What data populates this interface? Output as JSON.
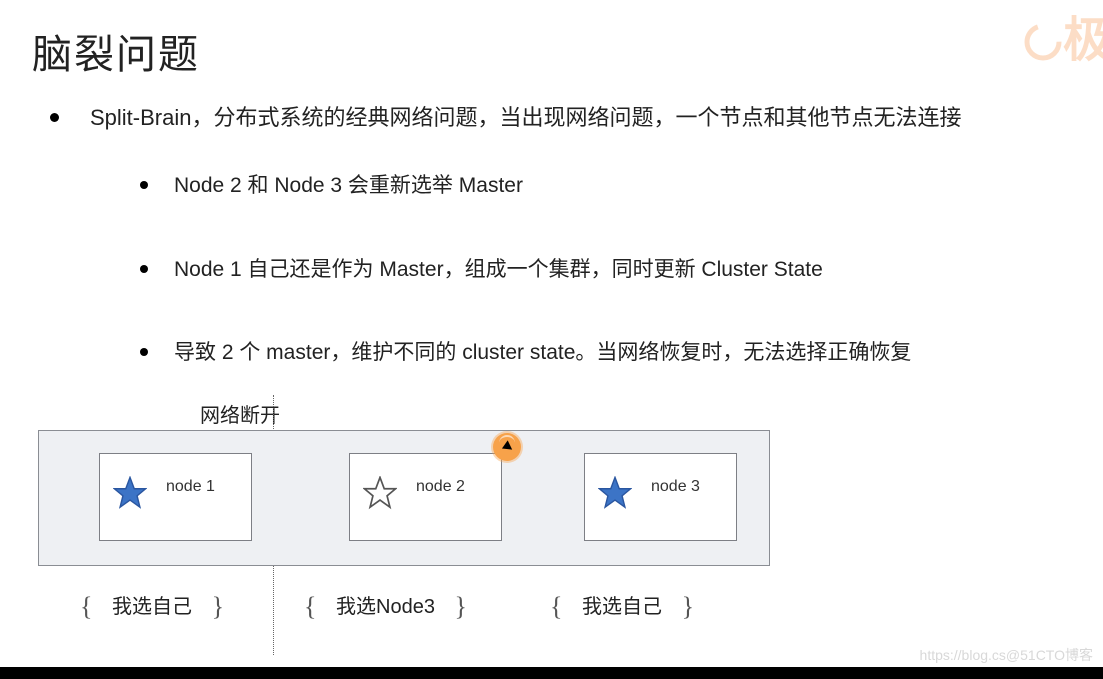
{
  "title": "脑裂问题",
  "logo_text": "极",
  "bullets": {
    "main": "Split-Brain，分布式系统的经典网络问题，当出现网络问题，一个节点和其他节点无法连接",
    "sub": [
      "Node 2 和 Node 3 会重新选举 Master",
      "Node 1 自己还是作为 Master，组成一个集群，同时更新 Cluster State",
      "导致 2 个 master，维护不同的 cluster state。当网络恢复时，无法选择正确恢复"
    ]
  },
  "break_label": "网络断开",
  "nodes": [
    {
      "label": "node 1",
      "star_filled": true
    },
    {
      "label": "node 2",
      "star_filled": false
    },
    {
      "label": "node 3",
      "star_filled": true
    }
  ],
  "votes": [
    "我选自己",
    "我选Node3",
    "我选自己"
  ],
  "watermark": "https://blog.cs@51CTO博客"
}
